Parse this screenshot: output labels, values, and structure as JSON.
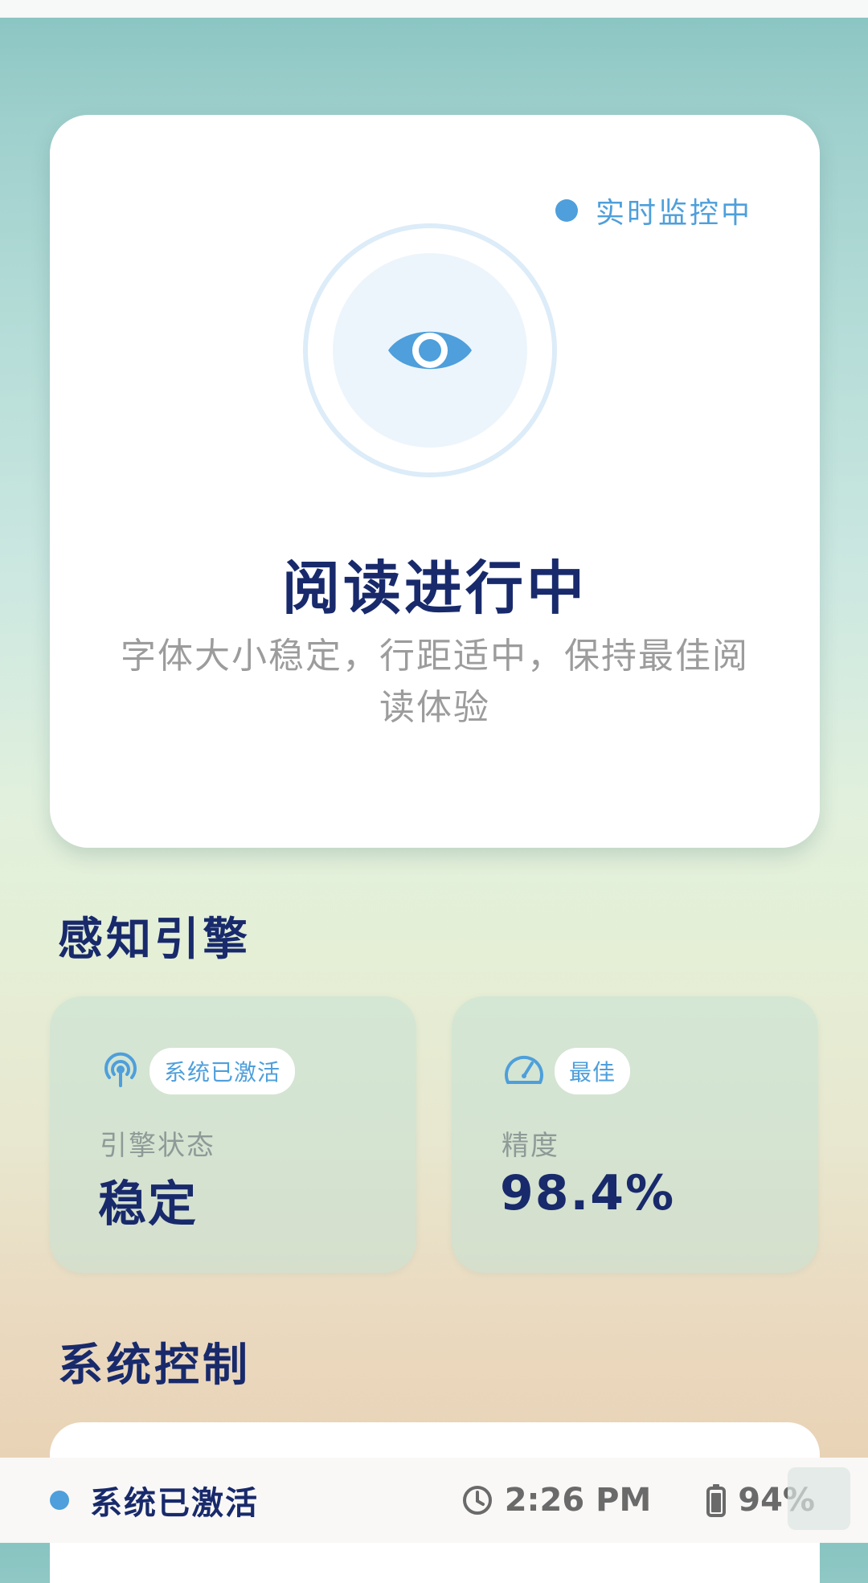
{
  "hero": {
    "live_status": "实时监控中",
    "title": "阅读进行中",
    "description": "字体大小稳定，行距适中，保持最佳阅读体验",
    "icon": "eye-icon"
  },
  "perception": {
    "section_title": "感知引擎",
    "cards": [
      {
        "icon": "signal-broadcast-icon",
        "badge": "系统已激活",
        "label": "引擎状态",
        "value": "稳定"
      },
      {
        "icon": "speedometer-icon",
        "badge": "最佳",
        "label": "精度",
        "value": "98.4%"
      }
    ]
  },
  "control": {
    "section_title": "系统控制"
  },
  "statusbar": {
    "status": "系统已激活",
    "time": "2:26 PM",
    "battery": "94%",
    "time_icon": "clock-icon",
    "battery_icon": "battery-icon"
  },
  "colors": {
    "accent": "#4e9fdb",
    "title": "#182a6b",
    "muted": "#9c9c9c"
  }
}
